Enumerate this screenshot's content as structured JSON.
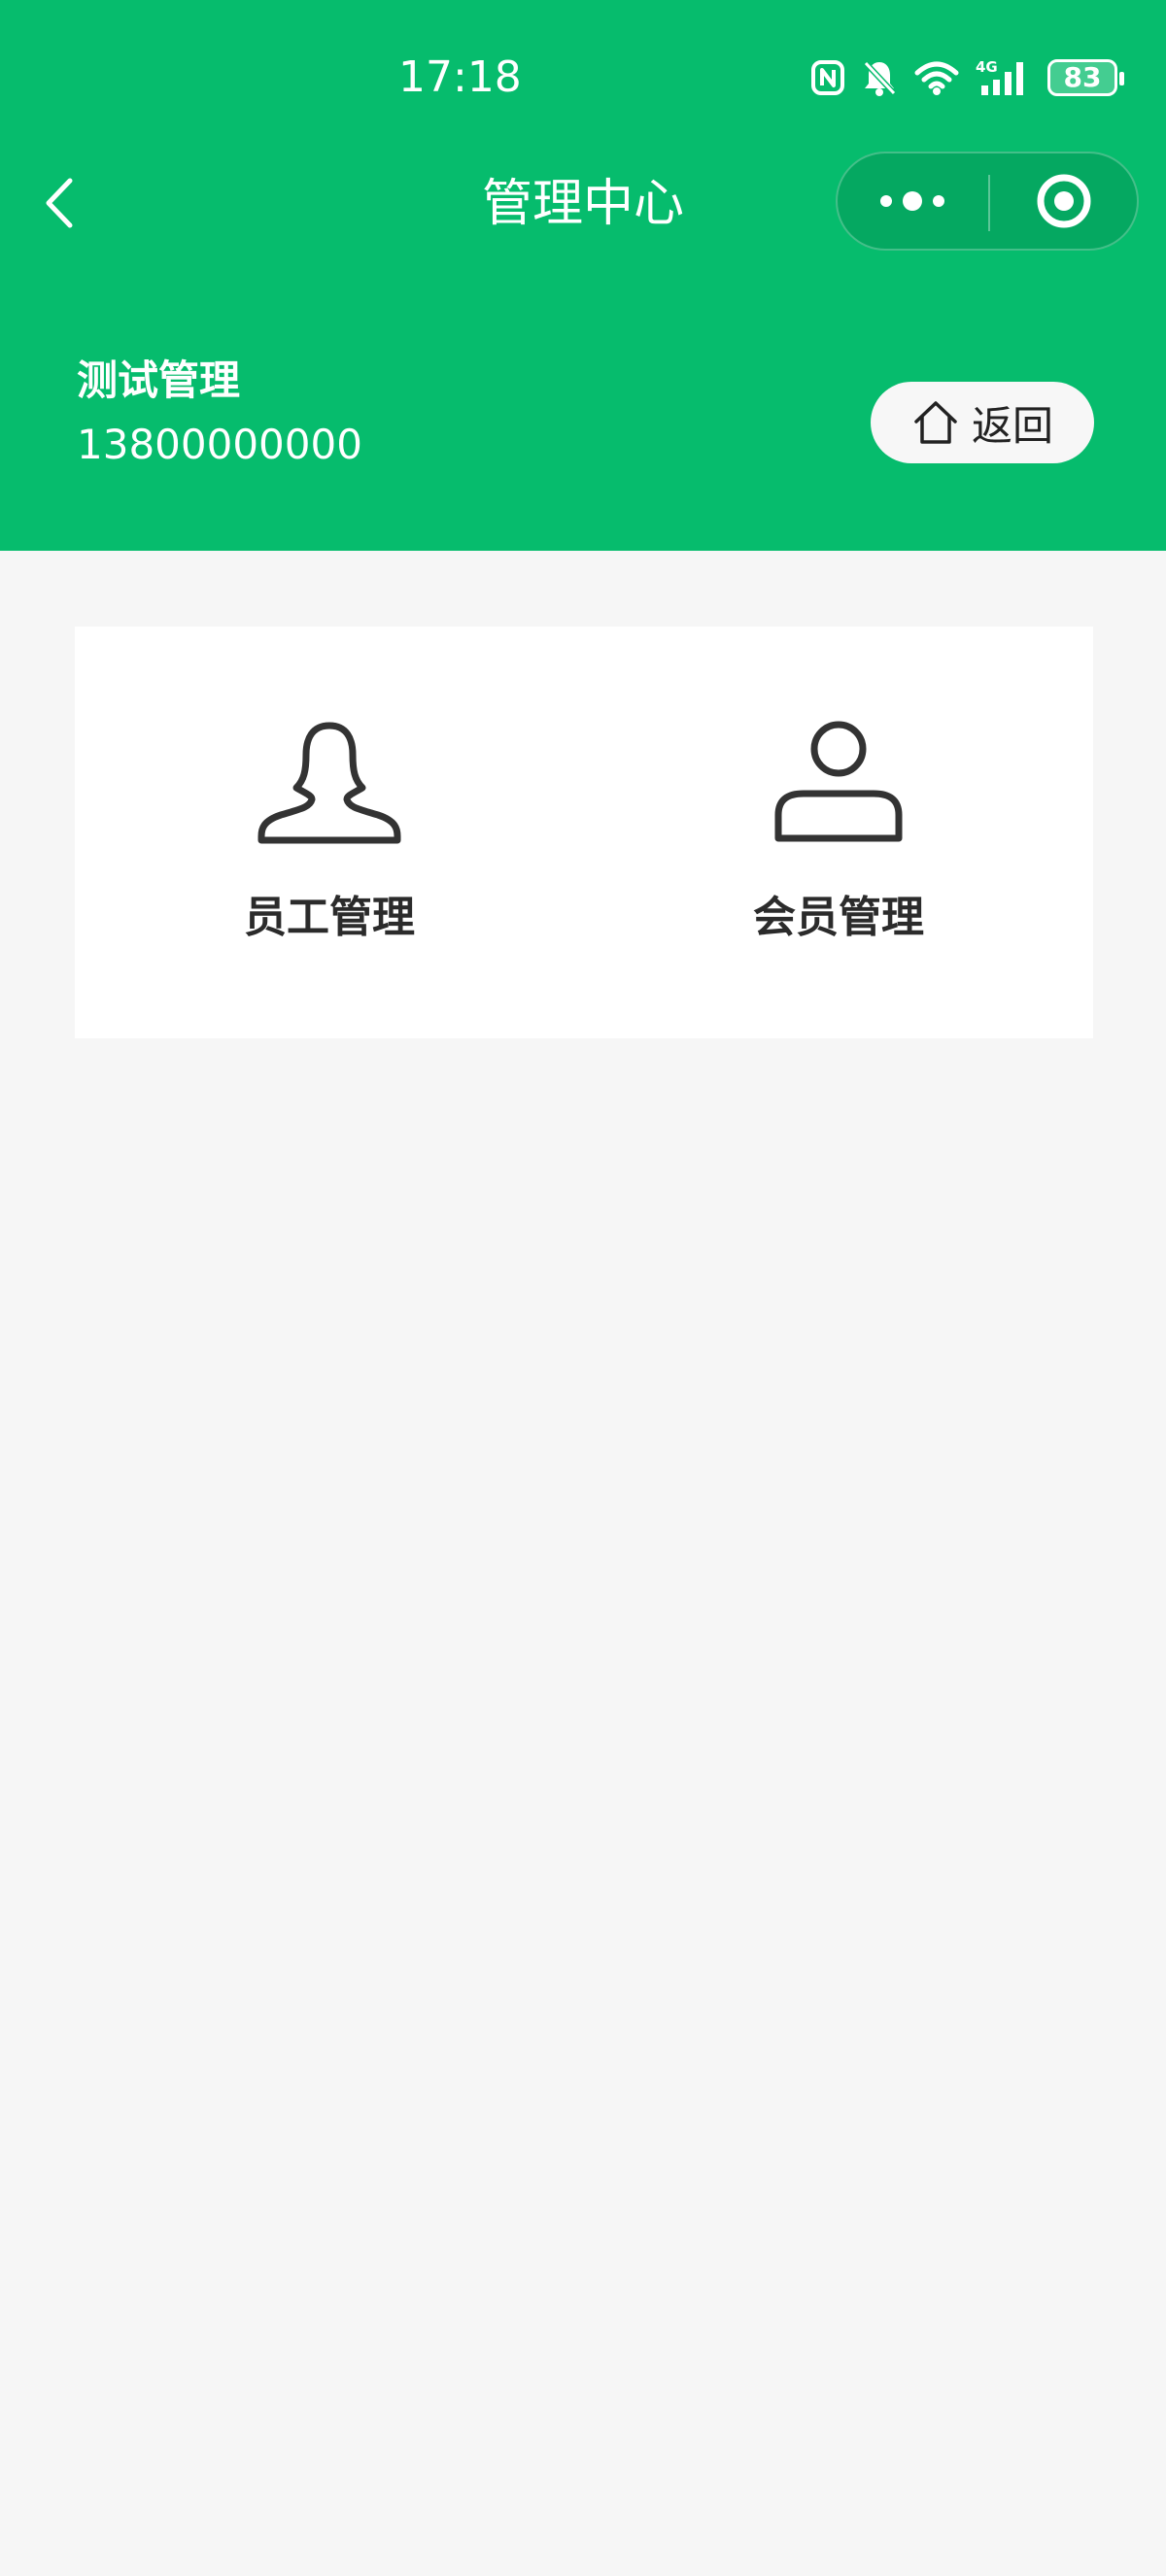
{
  "status_bar": {
    "time": "17:18",
    "battery": "83",
    "network": "4G"
  },
  "nav": {
    "title": "管理中心"
  },
  "user": {
    "name": "测试管理",
    "phone": "13800000000",
    "return_label": "返回"
  },
  "menu": {
    "items": [
      {
        "label": "员工管理",
        "icon": "female-user-icon"
      },
      {
        "label": "会员管理",
        "icon": "user-icon"
      }
    ]
  },
  "colors": {
    "primary": "#06bc6d",
    "background": "#f6f6f6",
    "card": "#ffffff",
    "text_dark": "#2b2b2b"
  }
}
